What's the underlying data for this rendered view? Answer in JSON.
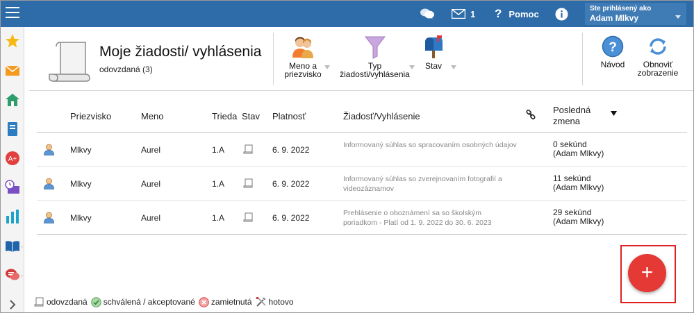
{
  "topbar": {
    "messages_count": "1",
    "help_label": "Pomoc",
    "user_caption": "Ste prihlásený ako",
    "user_name": "Adam Mlkvy"
  },
  "header": {
    "title": "Moje žiadosti/ vyhlásenia",
    "subtitle": "odovzdaná (3)",
    "filters": [
      {
        "label_line1": "Meno a",
        "label_line2": "priezvisko"
      },
      {
        "label_line1": "Typ",
        "label_line2": "žiadosti/vyhlásenia"
      },
      {
        "label_line1": "Stav",
        "label_line2": ""
      }
    ],
    "help_label": "Návod",
    "refresh_line1": "Obnoviť",
    "refresh_line2": "zobrazenie"
  },
  "table": {
    "columns": {
      "surname": "Priezvisko",
      "name": "Meno",
      "class": "Trieda",
      "status": "Stav",
      "validity": "Platnosť",
      "request": "Žiadosť/Vyhlásenie",
      "last_change_line1": "Posledná",
      "last_change_line2": "zmena"
    },
    "rows": [
      {
        "surname": "Mlkvy",
        "name": "Aurel",
        "class": "1.A",
        "validity": "6. 9. 2022",
        "request": "Informovaný súhlas so spracovaním osobných údajov",
        "change_line1": "0 sekúnd",
        "change_line2": "(Adam Mlkvy)"
      },
      {
        "surname": "Mlkvy",
        "name": "Aurel",
        "class": "1.A",
        "validity": "6. 9. 2022",
        "request": "Informovaný súhlas so zverejnovaním fotografií a videozáznamov",
        "change_line1": "11 sekúnd",
        "change_line2": "(Adam Mlkvy)"
      },
      {
        "surname": "Mlkvy",
        "name": "Aurel",
        "class": "1.A",
        "validity": "6. 9. 2022",
        "request": "Prehlásenie o oboznámení sa so školským poriadkom - Platí od 1. 9. 2022 do 30. 6. 2023",
        "change_line1": "29 sekúnd",
        "change_line2": "(Adam Mlkvy)"
      }
    ]
  },
  "fab_label": "+",
  "legend": {
    "submitted": "odovzdaná",
    "approved": "schválená / akceptované",
    "rejected": "zamietnutá",
    "done": "hotovo"
  },
  "colors": {
    "topbar": "#2d6ba9",
    "fab": "#e53935",
    "highlight": "#e02020"
  }
}
